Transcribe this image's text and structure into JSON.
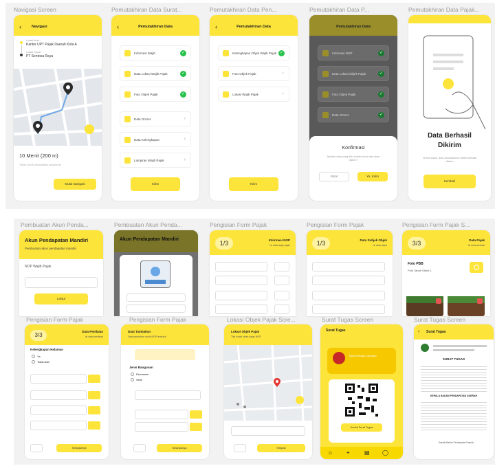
{
  "row1": {
    "titles": [
      "Navigasi Screen",
      "Pemutakhiran Data Surat...",
      "Pemutakhiran Data Pen...",
      "Pemutakhiran Data P...",
      "Pemutakhiran Data Pajak..."
    ],
    "nav": {
      "header": "Navigasi",
      "from_label": "Lokasi Anda",
      "from_value": "Kantor UPT Pajak Daerah Kota A",
      "to_label": "Lokasi Tujuan",
      "to_value": "PT Sentosa Raya",
      "eta": "10 Menit (200 m)",
      "eta_sub": "Tekan untuk melanjutkan perjalanan",
      "btn": "Mulai Navigasi"
    },
    "p2": {
      "header": "Pemutakhiran Data",
      "items": [
        "Informasi Wajib",
        "Data Lokasi Wajib Pajak",
        "Foto Objek Pajak",
        "Data Omzet",
        "Data Kelengkapan",
        "Lampiran Wajib Pajak"
      ],
      "btn": "Kirim"
    },
    "p3": {
      "header": "Pemutakhiran Data",
      "items": [
        "Kelengkapan Objek Wajib Pajak",
        "Foto Objek Pajak",
        "Lokasi Wajib Pajak"
      ],
      "btn": "Kirim"
    },
    "p4": {
      "header": "Pemutakhiran Data",
      "items": [
        "Informasi NOP",
        "Data Lokasi Objek Pajak",
        "Foto Objek Pajak",
        "Data Omzet"
      ],
      "modal_title": "Konfirmasi",
      "modal_text": "Apakah data yang diisi sudah benar dan akan dikirim?",
      "cancel": "Batal",
      "ok": "Ya, Kirim"
    },
    "p5": {
      "title_line1": "Data Berhasil",
      "title_line2": "Dikirim",
      "sub": "Terima kasih, data pemutakhiran telah berhasil dikirim",
      "btn": "Kembali"
    }
  },
  "row2": {
    "titles": [
      "Pembuatan Akun Penda...",
      "Pembuatan Akun Penda...",
      "Pengisian Form Pajak",
      "Pengisian Form Pajak",
      "Pengisian Form Pajak S..."
    ],
    "a1": {
      "header": "Akun Pendapatan Mandiri",
      "sub": "Pembuatan akun pendapatan mandiri",
      "field_label": "NOP Wajib Pajak",
      "btn": "Lanjut"
    },
    "a2": {
      "header": "Akun Pendapatan Mandiri"
    },
    "f1": {
      "step": "1/3",
      "title": "Informasi NOP",
      "sub": "Isi data wajib pajak"
    },
    "f2": {
      "step": "1/3",
      "title": "Data Subjek Objek",
      "sub": "Isi data objek"
    },
    "f3": {
      "step": "3/3",
      "title": "Data Pajak",
      "sub": "Isi dokumentasi",
      "photo_label": "Foto PBB",
      "photo_sub": "Foto Tanah Objek 1"
    }
  },
  "row3": {
    "titles": [
      "Pengisian Form Pajak",
      "Pengisian Form Pajak",
      "Lokasi Objek Pajak Scre...",
      "Surat Tugas Screen",
      "Surat Tugas Screen"
    ],
    "g1": {
      "step": "3/3",
      "title": "Data Penilaian",
      "sub": "Isi data penilaian",
      "opt_title": "Kelengkapan Halaman",
      "opt1": "Ya",
      "opt2": "Tidak Ada",
      "btn": "Selanjutnya"
    },
    "g2": {
      "title": "Data Tambahan",
      "sub": "Data tambahan untuk NOP tersebut",
      "group": "Jenis Bangunan",
      "opt1": "Permanen",
      "opt2": "Semi",
      "btn": "Selanjutnya"
    },
    "loc": {
      "title": "Lokasi Objek Pajak",
      "sub": "Titik lokasi objek pajak NOP",
      "btn": "Simpan"
    },
    "st1": {
      "title": "Surat Tugas",
      "name": "Nama Petugas Lapangan",
      "btn": "Unduh Surat Tugas"
    },
    "st2": {
      "title": "Surat Tugas",
      "doc_title": "SURAT TUGAS",
      "doc_heading": "KEPALA BADAN PENDAPATAN DAERAH",
      "sign": "Kepala Badan Pendapatan Daerah"
    }
  },
  "colors": {
    "accent": "#fde43a",
    "check": "#27c24c",
    "pin": "#2a2a2a"
  }
}
